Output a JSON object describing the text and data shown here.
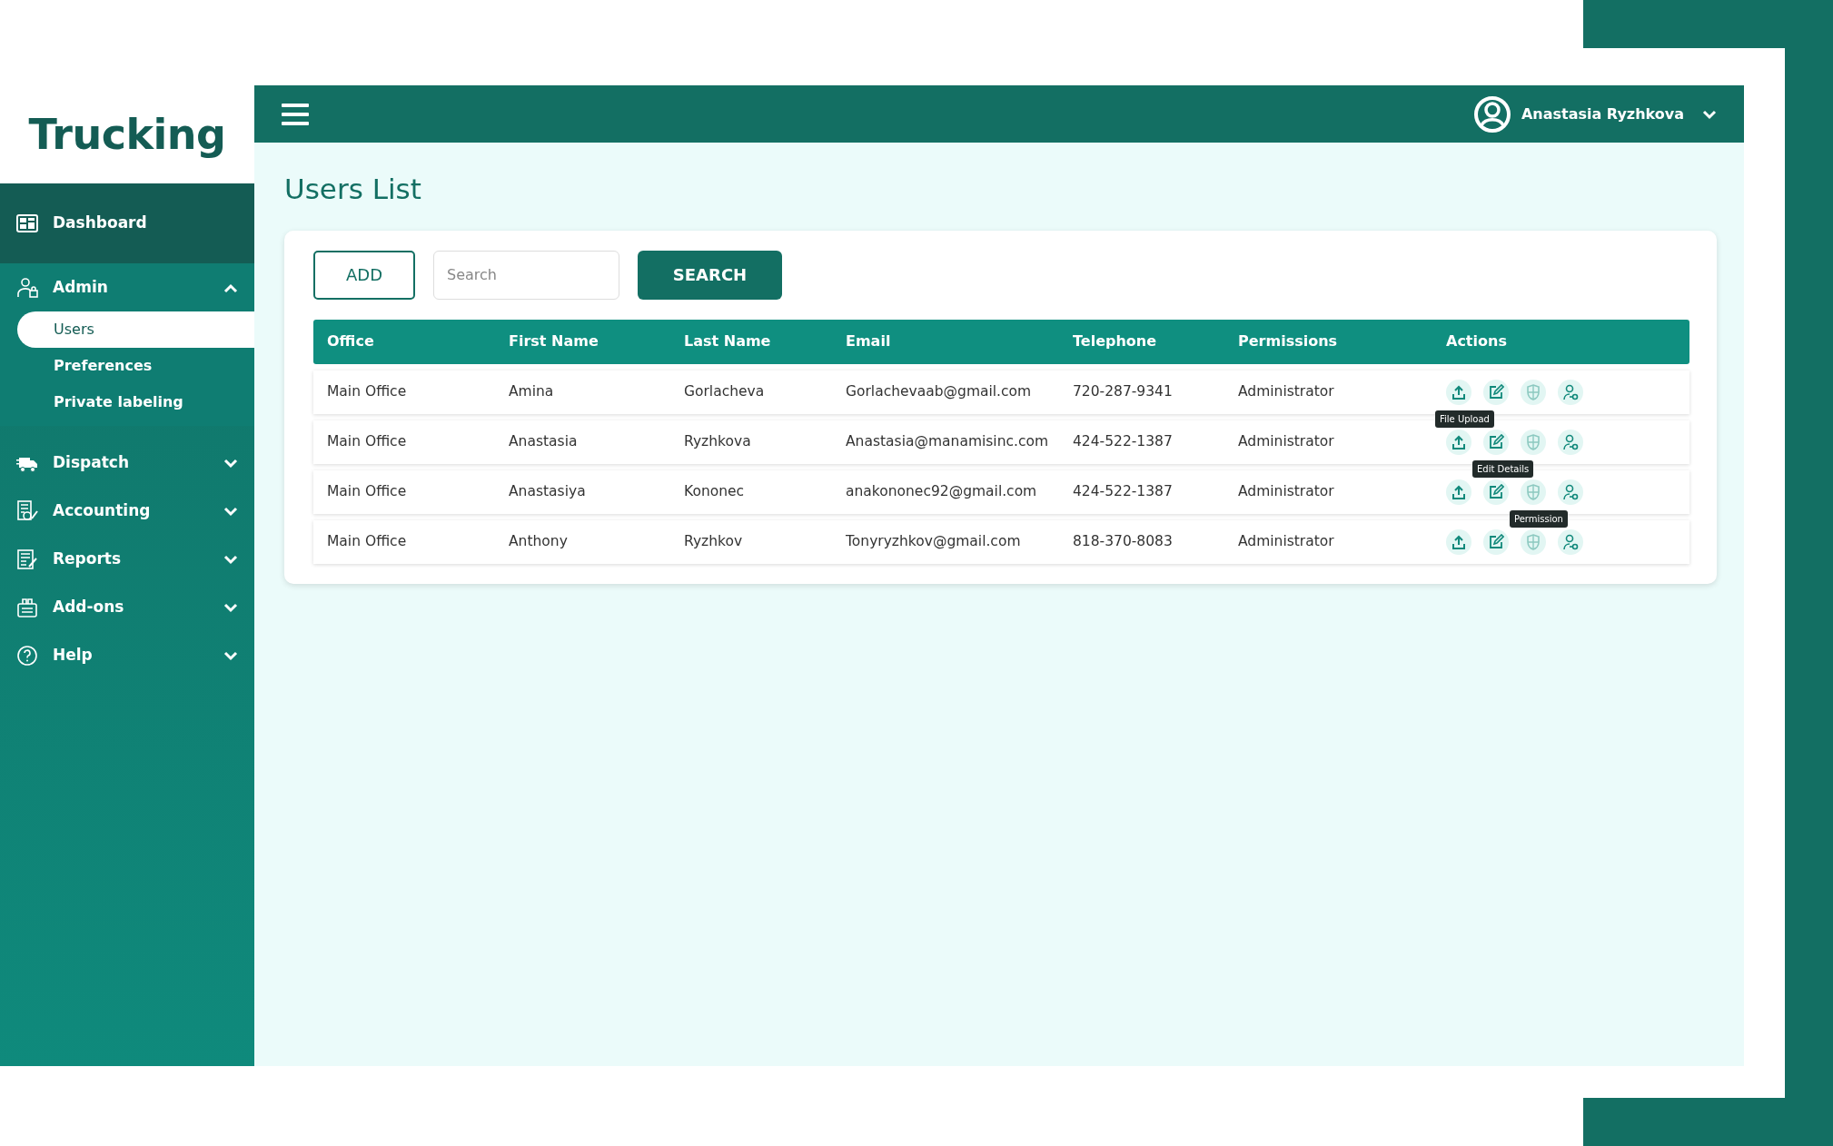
{
  "logo": "Trucking",
  "sidebar": {
    "items": [
      {
        "kind": "dashboard",
        "label": "Dashboard",
        "hovered": true
      },
      {
        "kind": "admin",
        "label": "Admin",
        "hovered": false,
        "expanded": true,
        "children": [
          {
            "label": "Users",
            "selected": true
          },
          {
            "label": "Preferences",
            "selected": false
          },
          {
            "label": "Private labeling",
            "selected": false
          }
        ]
      },
      {
        "kind": "dispatch",
        "label": "Dispatch",
        "hovered": false,
        "expanded": false
      },
      {
        "kind": "accounting",
        "label": "Accounting",
        "hovered": false,
        "expanded": false
      },
      {
        "kind": "reports",
        "label": "Reports",
        "hovered": false,
        "expanded": false
      },
      {
        "kind": "addons",
        "label": "Add-ons",
        "hovered": false,
        "expanded": false
      },
      {
        "kind": "help",
        "label": "Help",
        "hovered": false,
        "expanded": false
      }
    ]
  },
  "header": {
    "user_name": "Anastasia Ryzhkova"
  },
  "page_title": "Users List",
  "toolbar": {
    "add_button": "ADD",
    "search": {
      "placeholder": "Search"
    },
    "search_button": "SEARCH"
  },
  "table": {
    "columns": [
      "Office",
      "First Name",
      "Last Name",
      "Email",
      "Telephone",
      "Permissions",
      "Actions"
    ],
    "rows": [
      {
        "cells": [
          "Main Office",
          "Amina",
          "Gorlacheva",
          "Gorlachevaab@gmail.com",
          "720-287-9341",
          "Administrator"
        ],
        "actions": [
          {
            "kind": "upload",
            "tooltip": "File Upload"
          },
          {
            "kind": "edit"
          },
          {
            "kind": "shield"
          },
          {
            "kind": "user"
          }
        ]
      },
      {
        "cells": [
          "Main Office",
          "Anastasia",
          "Ryzhkova",
          "Anastasia@manamisinc.com",
          "424-522-1387",
          "Administrator"
        ],
        "actions": [
          {
            "kind": "upload"
          },
          {
            "kind": "edit",
            "tooltip": "Edit Details"
          },
          {
            "kind": "shield"
          },
          {
            "kind": "user"
          }
        ]
      },
      {
        "cells": [
          "Main Office",
          "Anastasiya",
          "Kononec",
          "anakononec92@gmail.com",
          "424-522-1387",
          "Administrator"
        ],
        "actions": [
          {
            "kind": "upload"
          },
          {
            "kind": "edit"
          },
          {
            "kind": "shield",
            "tooltip": "Permission"
          },
          {
            "kind": "user"
          }
        ]
      },
      {
        "cells": [
          "Main Office",
          "Anthony",
          "Ryzhkov",
          "Tonyryzhkov@gmail.com",
          "818-370-8083",
          "Administrator"
        ],
        "actions": [
          {
            "kind": "upload"
          },
          {
            "kind": "edit"
          },
          {
            "kind": "shield"
          },
          {
            "kind": "user"
          }
        ]
      }
    ]
  }
}
